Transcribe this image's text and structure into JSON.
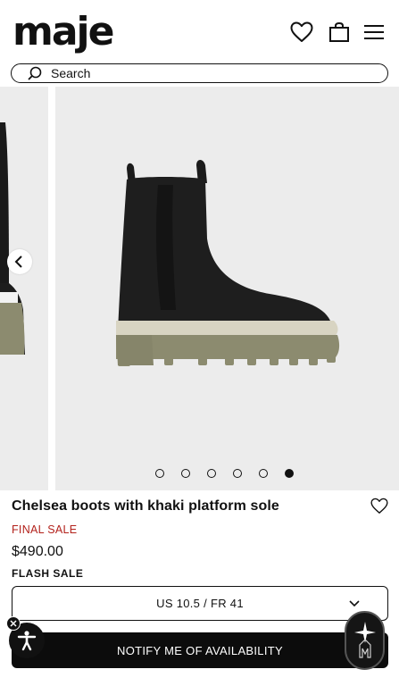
{
  "header": {
    "logo": "maje",
    "wishlist_icon": "heart-icon",
    "bag_icon": "shopping-bag-icon",
    "menu_icon": "hamburger-menu-icon"
  },
  "search": {
    "label": "Search",
    "icon": "search-icon"
  },
  "carousel": {
    "prev_icon": "chevron-left-icon",
    "dot_count": 6,
    "active_index": 5
  },
  "product": {
    "title": "Chelsea boots with khaki platform sole",
    "final_sale": "FINAL SALE",
    "price": "$490.00",
    "flash_sale": "FLASH SALE",
    "size_selected": "US 10.5 / FR 41",
    "notify_label": "NOTIFY ME OF AVAILABILITY"
  },
  "colors": {
    "final_sale": "#b3221c",
    "button_bg": "#0c0c0c",
    "image_bg": "#ececec",
    "sole": "#8c8b6f"
  }
}
